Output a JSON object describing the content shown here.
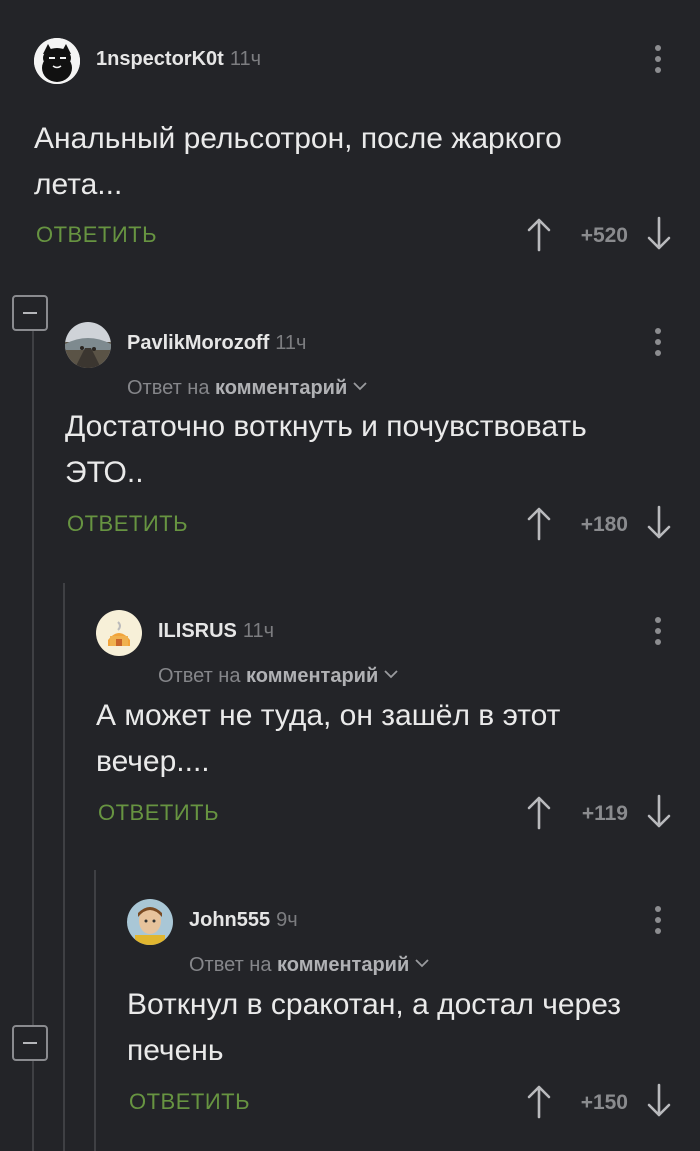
{
  "comments": [
    {
      "author": "1nspectorK0t",
      "time": "11ч",
      "reply_to": null,
      "text_lines": [
        "Анальный рельсотрон, после жаркого",
        "лета..."
      ],
      "reply_label": "ОТВЕТИТЬ",
      "rating": "+520"
    },
    {
      "author": "PavlikMorozoff",
      "time": "11ч",
      "reply_to": {
        "prefix": "Ответ на",
        "target": "комментарий"
      },
      "text_lines": [
        "Достаточно воткнуть и почувствовать",
        "ЭТО.."
      ],
      "reply_label": "ОТВЕТИТЬ",
      "rating": "+180"
    },
    {
      "author": "ILISRUS",
      "time": "11ч",
      "reply_to": {
        "prefix": "Ответ на",
        "target": "комментарий"
      },
      "text_lines": [
        "А может не туда, он зашёл в этот",
        "вечер...."
      ],
      "reply_label": "ОТВЕТИТЬ",
      "rating": "+119"
    },
    {
      "author": "John555",
      "time": "9ч",
      "reply_to": {
        "prefix": "Ответ на",
        "target": "комментарий"
      },
      "text_lines": [
        "Воткнул в сракотан, а достал через",
        "печень"
      ],
      "reply_label": "ОТВЕТИТЬ",
      "rating": "+150"
    }
  ],
  "colors": {
    "background": "#232428",
    "reply_green": "#679441",
    "thread_line": "#3f4044"
  },
  "icons": {
    "collapse": "minus-square-icon",
    "more": "vertical-dots-icon",
    "upvote": "arrow-up-icon",
    "downvote": "arrow-down-icon",
    "dropdown": "chevron-down-icon"
  }
}
